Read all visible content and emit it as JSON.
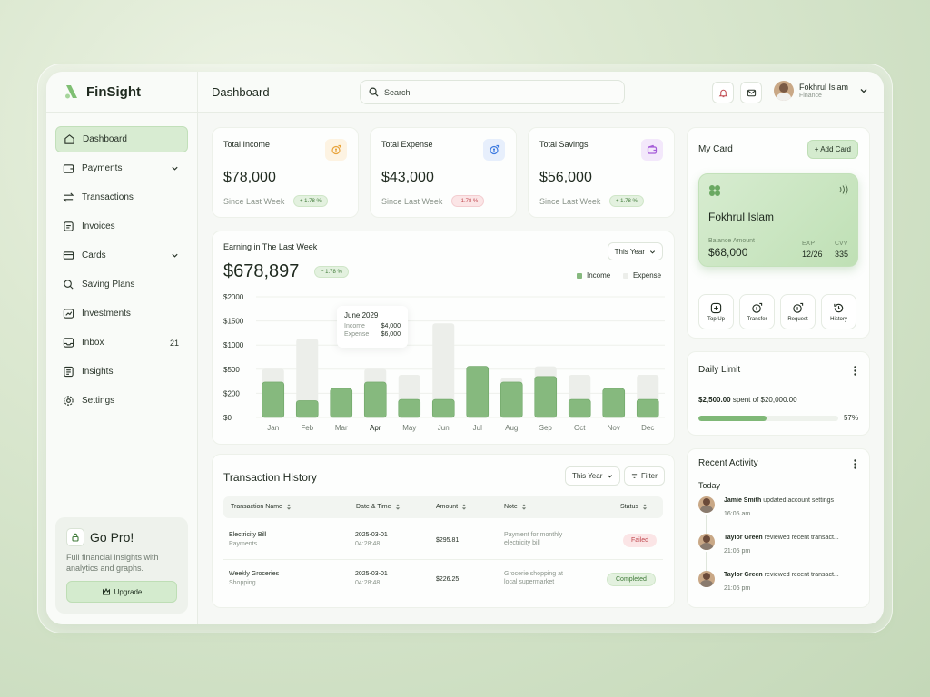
{
  "app": {
    "name": "FinSight",
    "page_title": "Dashboard"
  },
  "search": {
    "placeholder": "Search"
  },
  "user": {
    "name": "Fokhrul Islam",
    "role": "Finance"
  },
  "sidebar": {
    "items": [
      {
        "label": "Dashboard",
        "icon": "home-icon",
        "active": true
      },
      {
        "label": "Payments",
        "icon": "wallet-icon",
        "expandable": true
      },
      {
        "label": "Transactions",
        "icon": "swap-icon"
      },
      {
        "label": "Invoices",
        "icon": "invoice-icon"
      },
      {
        "label": "Cards",
        "icon": "card-icon",
        "expandable": true
      },
      {
        "label": "Saving Plans",
        "icon": "piggy-icon"
      },
      {
        "label": "Investments",
        "icon": "chart-icon"
      },
      {
        "label": "Inbox",
        "icon": "inbox-icon",
        "badge": "21"
      },
      {
        "label": "Insights",
        "icon": "document-icon"
      },
      {
        "label": "Settings",
        "icon": "gear-icon"
      }
    ],
    "pro": {
      "title": "Go Pro!",
      "text": "Full financial insights with analytics and graphs.",
      "button": "Upgrade"
    }
  },
  "stats": [
    {
      "title": "Total Income",
      "value": "$78,000",
      "since": "Since Last Week",
      "change": "+ 1.78 %",
      "trend": "up",
      "icon": "income-icon",
      "icon_color": "#e8a33a",
      "icon_bg": "#fdf3e2"
    },
    {
      "title": "Total Expense",
      "value": "$43,000",
      "since": "Since Last Week",
      "change": "- 1.78 %",
      "trend": "down",
      "icon": "expense-icon",
      "icon_color": "#3d7be0",
      "icon_bg": "#e7effc"
    },
    {
      "title": "Total Savings",
      "value": "$56,000",
      "since": "Since Last Week",
      "change": "+ 1.78 %",
      "trend": "up",
      "icon": "savings-icon",
      "icon_color": "#a55bd8",
      "icon_bg": "#f3e8fb"
    }
  ],
  "earnings": {
    "title": "Earning in The Last Week",
    "value": "$678,897",
    "change": "+ 1.78 %",
    "period": "This Year",
    "legend_income": "Income",
    "legend_expense": "Expense",
    "tooltip": {
      "title": "June 2029",
      "income_label": "Income",
      "income_value": "$4,000",
      "expense_label": "Expense",
      "expense_value": "$6,000"
    }
  },
  "chart_data": {
    "type": "bar",
    "categories": [
      "Jan",
      "Feb",
      "Mar",
      "Apr",
      "May",
      "Jun",
      "Jul",
      "Aug",
      "Sep",
      "Oct",
      "Nov",
      "Dec"
    ],
    "y_tick_labels": [
      "$0",
      "$200",
      "$500",
      "$1000",
      "$1500",
      "$2000"
    ],
    "series": [
      {
        "name": "Income",
        "color": "#86b97e",
        "values": [
          340,
          140,
          260,
          340,
          150,
          150,
          560,
          340,
          410,
          150,
          260,
          150
        ]
      },
      {
        "name": "Expense",
        "color": "#eceeea",
        "values": [
          510,
          1130,
          260,
          510,
          430,
          1450,
          560,
          390,
          560,
          430,
          260,
          430
        ]
      }
    ],
    "highlight": "Apr",
    "grid": true,
    "legend": "top-right"
  },
  "transactions": {
    "title": "Transaction History",
    "period": "This Year",
    "filter": "Filter",
    "columns": [
      "Transaction Name",
      "Date & Time",
      "Amount",
      "Note",
      "Status"
    ],
    "rows": [
      {
        "name": "Electricity Bill",
        "category": "Payments",
        "date": "2025-03-01",
        "time": "04:28:48",
        "amount": "$295.81",
        "note_1": "Payment for monthly",
        "note_2": "electricity bill",
        "status": "Failed"
      },
      {
        "name": "Weekly Groceries",
        "category": "Shopping",
        "date": "2025-03-01",
        "time": "04:28:48",
        "amount": "$226.25",
        "note_1": "Grocerie shopping at",
        "note_2": "local supermarket",
        "status": "Completed"
      }
    ]
  },
  "my_card": {
    "title": "My Card",
    "add_label": "+ Add Card",
    "holder": "Fokhrul Islam",
    "balance_label": "Balance Amount",
    "balance": "$68,000",
    "exp_label": "EXP",
    "exp": "12/26",
    "cvv_label": "CVV",
    "cvv": "335",
    "actions": [
      {
        "label": "Top Up",
        "icon": "plus-square-icon"
      },
      {
        "label": "Transfer",
        "icon": "transfer-icon"
      },
      {
        "label": "Request",
        "icon": "request-icon"
      },
      {
        "label": "History",
        "icon": "history-icon"
      }
    ]
  },
  "daily_limit": {
    "title": "Daily Limit",
    "spent": "$2,500.00",
    "text": "spent of $20,000.00",
    "percent_label": "57%",
    "fill_fraction": 0.49
  },
  "recent_activity": {
    "title": "Recent Activity",
    "today": "Today",
    "items": [
      {
        "name": "Jamie Smith",
        "action": "updated account settings",
        "time": "16:05 am"
      },
      {
        "name": "Taylor Green",
        "action": "reviewed recent transact...",
        "time": "21:05 pm"
      },
      {
        "name": "Taylor Green",
        "action": "reviewed recent transact...",
        "time": "21:05 pm"
      }
    ]
  }
}
